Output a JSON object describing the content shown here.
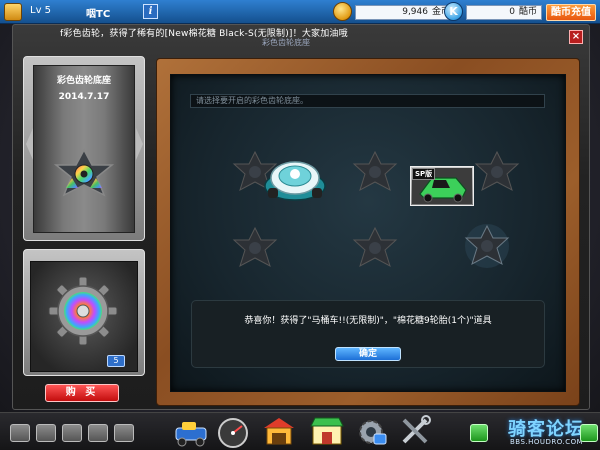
{
  "topbar": {
    "level": "Lv 5",
    "player_name": "咽TC",
    "info_label": "i",
    "coins": {
      "value": "9,946",
      "unit": "金币"
    },
    "kcoins": {
      "icon_label": "K",
      "value": "0",
      "unit": "酷币"
    },
    "recharge_label": "酷币充值"
  },
  "dialog": {
    "broadcast": "f彩色齿轮，获得了稀有的[New棉花糖 Black-S(无限制)]！大家加油哦",
    "title": "彩色齿轮底座",
    "close_label": "×"
  },
  "left_panel": {
    "chassis_name": "彩色齿轮底座",
    "chassis_date": "2014.7.17",
    "gear_count": "5",
    "buy_label": "购 买"
  },
  "board": {
    "search_placeholder": "请选择要开启的彩色齿轮底座。",
    "kart_badge": "SP版",
    "result_text": "恭喜你！获得了\"马桶车!!(无限制)\"，\"棉花糖9轮胎(1个)\"道具",
    "ok_label": "确定"
  },
  "footer": {
    "forum_logo": "骑客论坛",
    "forum_url": "BBS.HOUDRO.COM"
  },
  "colors": {
    "top_bar": "#1f64b0",
    "chalkboard": "#17252d",
    "wood_frame": "#9c5e2b",
    "buy_button": "#d31b1b",
    "ok_button": "#2f86e6"
  }
}
